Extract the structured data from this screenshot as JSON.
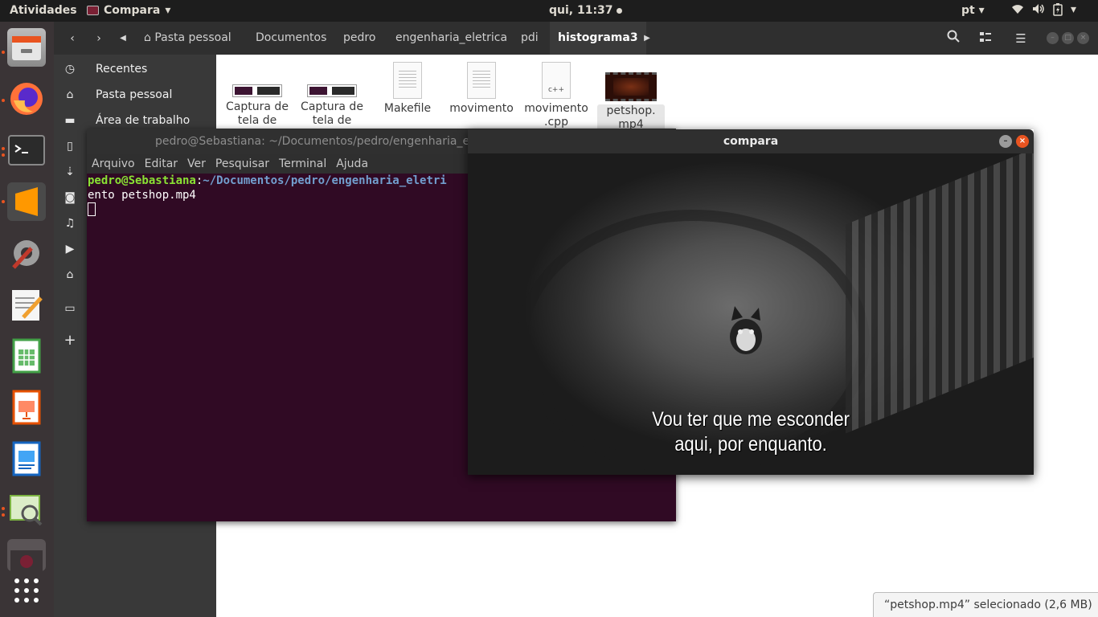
{
  "topbar": {
    "activities": "Atividades",
    "app_menu": "Compara",
    "clock": "qui, 11:37",
    "language": "pt"
  },
  "dock": {
    "items": [
      "files-icon",
      "firefox-icon",
      "terminal-icon",
      "sublime-text-icon",
      "settings-icon",
      "text-editor-icon",
      "spreadsheet-icon",
      "presentation-icon",
      "writer-icon",
      "image-viewer-icon",
      "window-thumbnail",
      "app-grid-icon"
    ],
    "accent": "#e95420"
  },
  "file_manager": {
    "breadcrumbs": [
      "Pasta pessoal",
      "Documentos",
      "pedro",
      "engenharia_eletrica",
      "pdi",
      "histograma3"
    ],
    "sidebar": [
      "Recentes",
      "Pasta pessoal",
      "Área de trabalho"
    ],
    "files": [
      {
        "name_line1": "Captura de",
        "name_line2": "tela de"
      },
      {
        "name_line1": "Captura de",
        "name_line2": "tela de"
      },
      {
        "name_line1": "Makefile",
        "name_line2": ""
      },
      {
        "name_line1": "movimento",
        "name_line2": ""
      },
      {
        "name_line1": "movimento",
        "name_line2": ".cpp",
        "thumb_text": "c++"
      },
      {
        "name_line1": "petshop.",
        "name_line2": "mp4"
      }
    ],
    "status": "“petshop.mp4” selecionado  (2,6 MB)"
  },
  "terminal": {
    "title": "pedro@Sebastiana: ~/Documentos/pedro/engenharia_e",
    "menu": [
      "Arquivo",
      "Editar",
      "Ver",
      "Pesquisar",
      "Terminal",
      "Ajuda"
    ],
    "prompt_user": "pedro@Sebastiana",
    "prompt_sep": ":",
    "prompt_path": "~/Documentos/pedro/engenharia_eletri",
    "line2": "ento petshop.mp4",
    "background": "#300a24"
  },
  "compara": {
    "title": "compara",
    "subtitle_line1": "Vou ter que me esconder",
    "subtitle_line2": "aqui, por enquanto."
  }
}
